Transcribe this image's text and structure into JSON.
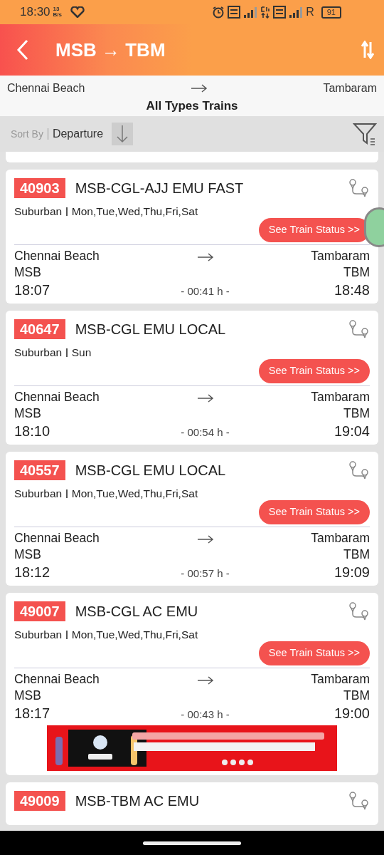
{
  "status_bar": {
    "time": "18:30",
    "speed_value": "13",
    "speed_unit": "B/s",
    "roaming": "R",
    "battery": "91"
  },
  "header": {
    "title": "MSB → TBM"
  },
  "route": {
    "from": "Chennai Beach",
    "to": "Tambaram",
    "train_type": "All Types Trains"
  },
  "sort": {
    "label": "Sort By",
    "value": "Departure"
  },
  "trains": [
    {
      "kind": "full",
      "number": "40903",
      "name": "MSB-CGL-AJJ EMU FAST",
      "type": "Suburban",
      "days": "Mon,Tue,Wed,Thu,Fri,Sat",
      "button": "See Train Status >>",
      "from_name": "Chennai Beach",
      "from_code": "MSB",
      "departure": "18:07",
      "duration": "- 00:41 h -",
      "to_name": "Tambaram",
      "to_code": "TBM",
      "arrival": "18:48",
      "ad": false
    },
    {
      "kind": "full",
      "number": "40647",
      "name": "MSB-CGL EMU LOCAL",
      "type": "Suburban",
      "days": "Sun",
      "button": "See Train Status >>",
      "from_name": "Chennai Beach",
      "from_code": "MSB",
      "departure": "18:10",
      "duration": "- 00:54 h -",
      "to_name": "Tambaram",
      "to_code": "TBM",
      "arrival": "19:04",
      "ad": false
    },
    {
      "kind": "full",
      "number": "40557",
      "name": "MSB-CGL EMU LOCAL",
      "type": "Suburban",
      "days": "Mon,Tue,Wed,Thu,Fri,Sat",
      "button": "See Train Status >>",
      "from_name": "Chennai Beach",
      "from_code": "MSB",
      "departure": "18:12",
      "duration": "- 00:57 h -",
      "to_name": "Tambaram",
      "to_code": "TBM",
      "arrival": "19:09",
      "ad": false
    },
    {
      "kind": "full",
      "number": "49007",
      "name": "MSB-CGL AC EMU",
      "type": "Suburban",
      "days": "Mon,Tue,Wed,Thu,Fri,Sat",
      "button": "See Train Status >>",
      "from_name": "Chennai Beach",
      "from_code": "MSB",
      "departure": "18:17",
      "duration": "- 00:43 h -",
      "to_name": "Tambaram",
      "to_code": "TBM",
      "arrival": "19:00",
      "ad": true
    },
    {
      "kind": "cut",
      "number": "49009",
      "name": "MSB-TBM AC EMU"
    }
  ]
}
